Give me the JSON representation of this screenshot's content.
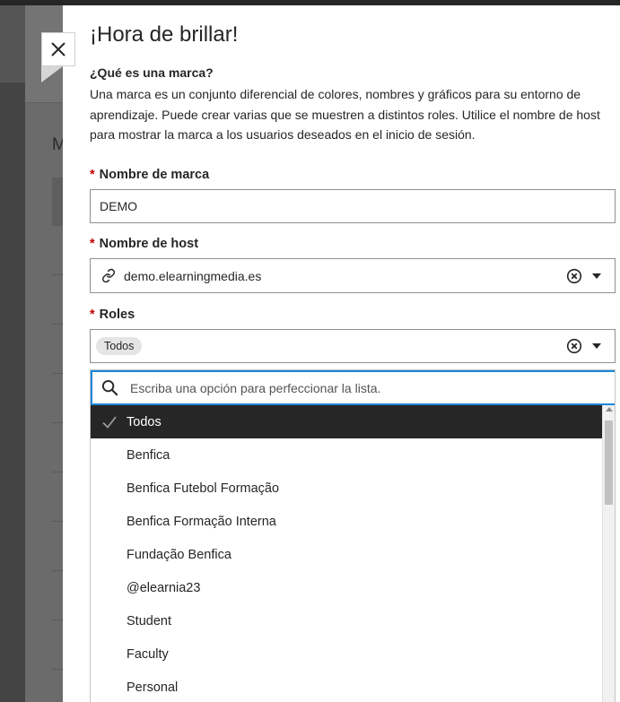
{
  "background": {
    "heading_letter": "M"
  },
  "panel": {
    "title": "¡Hora de brillar!",
    "info_heading": "¿Qué es una marca?",
    "info_text": "Una marca es un conjunto diferencial de colores, nombres y gráficos para su entorno de aprendizaje. Puede crear varias que se muestren a distintos roles. Utilice el nombre de host para mostrar la marca a los usuarios deseados en el inicio de sesión."
  },
  "form": {
    "required_mark": "*",
    "brand_name": {
      "label": "Nombre de marca",
      "value": "DEMO"
    },
    "host_name": {
      "label": "Nombre de host",
      "value": "demo.elearningmedia.es",
      "icon": "link-icon"
    },
    "roles": {
      "label": "Roles",
      "chip": "Todos",
      "filter_placeholder": "Escriba una opción para perfeccionar la lista.",
      "options": [
        {
          "label": "Todos",
          "selected": true
        },
        {
          "label": "Benfica",
          "selected": false
        },
        {
          "label": "Benfica Futebol Formação",
          "selected": false
        },
        {
          "label": "Benfica Formação Interna",
          "selected": false
        },
        {
          "label": "Fundação Benfica",
          "selected": false
        },
        {
          "label": "@elearnia23",
          "selected": false
        },
        {
          "label": "Student",
          "selected": false
        },
        {
          "label": "Faculty",
          "selected": false
        },
        {
          "label": "Personal",
          "selected": false
        }
      ]
    }
  },
  "colors": {
    "required": "#c30000",
    "focus": "#1a86d9",
    "selected_bg": "#262626",
    "overlay": "#3b3b3b"
  }
}
